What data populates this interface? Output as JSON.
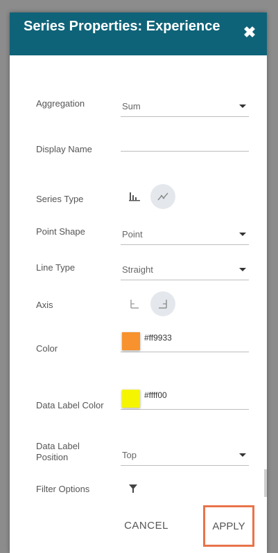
{
  "dialog": {
    "title": "Series Properties: Experience"
  },
  "fields": {
    "aggregation": {
      "label": "Aggregation",
      "value": "Sum"
    },
    "display_name": {
      "label": "Display Name",
      "value": ""
    },
    "series_type": {
      "label": "Series Type",
      "options": [
        "bar-chart-icon",
        "line-chart-icon"
      ],
      "selected": "line-chart-icon"
    },
    "point_shape": {
      "label": "Point Shape",
      "value": "Point"
    },
    "line_type": {
      "label": "Line Type",
      "value": "Straight"
    },
    "axis": {
      "label": "Axis",
      "options": [
        "left-axis-icon",
        "right-axis-icon"
      ],
      "selected": "right-axis-icon"
    },
    "color": {
      "label": "Color",
      "value": "#ff9933",
      "swatch": "#f7922e"
    },
    "data_label_color": {
      "label": "Data Label Color",
      "value": "#ffff00",
      "swatch": "#f5f500"
    },
    "data_label_position": {
      "label": "Data Label Position",
      "value": "Top"
    },
    "filter_options": {
      "label": "Filter Options",
      "icon": "filter-icon"
    }
  },
  "footer": {
    "cancel_label": "CANCEL",
    "apply_label": "APPLY"
  },
  "colors": {
    "header_bg": "#0f6378",
    "highlight_border": "#e8734a"
  }
}
